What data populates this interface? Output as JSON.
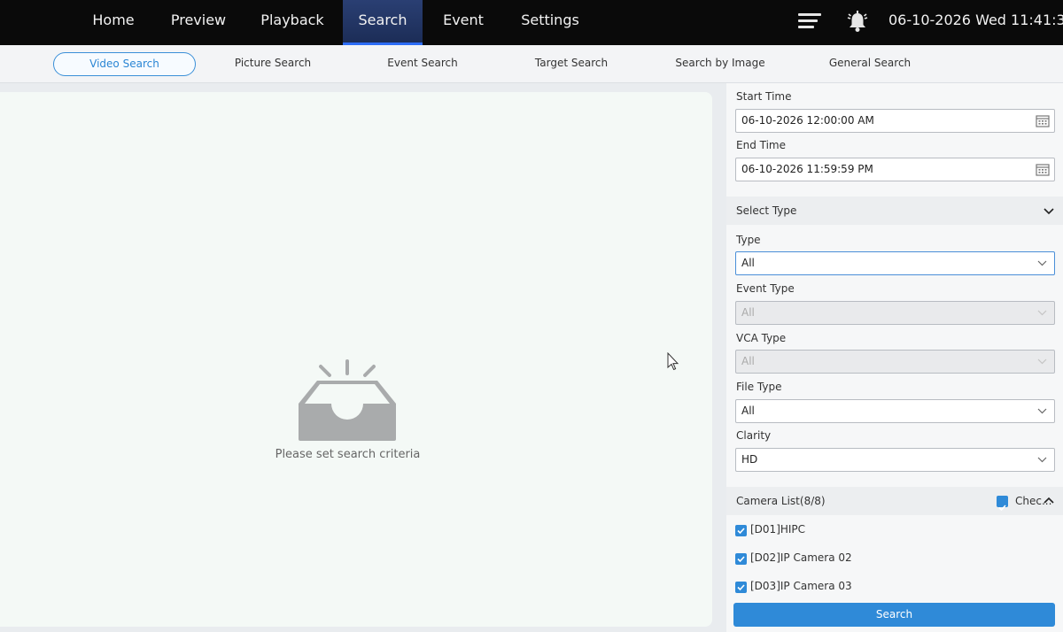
{
  "topnav": {
    "items": [
      {
        "label": "Home"
      },
      {
        "label": "Preview"
      },
      {
        "label": "Playback"
      },
      {
        "label": "Search"
      },
      {
        "label": "Event"
      },
      {
        "label": "Settings"
      }
    ],
    "active": "Search",
    "clock": "06-10-2026 Wed 11:41:30",
    "icons": [
      "menu-icon",
      "bell-icon"
    ]
  },
  "subnav": {
    "items": [
      {
        "label": "Video Search"
      },
      {
        "label": "Picture Search"
      },
      {
        "label": "Event Search"
      },
      {
        "label": "Target Search"
      },
      {
        "label": "Search by Image"
      },
      {
        "label": "General Search"
      }
    ],
    "active": "Video Search"
  },
  "main": {
    "empty_text": "Please set search criteria"
  },
  "panel": {
    "start_time_label": "Start Time",
    "start_time_value": "06-10-2026 12:00:00 AM",
    "end_time_label": "End Time",
    "end_time_value": "06-10-2026 11:59:59 PM",
    "select_type_title": "Select Type",
    "type_label": "Type",
    "type_value": "All",
    "event_type_label": "Event Type",
    "event_type_value": "All",
    "vca_type_label": "VCA Type",
    "vca_type_value": "All",
    "file_type_label": "File Type",
    "file_type_value": "All",
    "clarity_label": "Clarity",
    "clarity_value": "HD",
    "camera_list_title": "Camera List(8/8)",
    "check_all_label": "Chec...",
    "cameras": [
      {
        "label": "[D01]HIPC",
        "checked": true
      },
      {
        "label": "[D02]IP Camera 02",
        "checked": true
      },
      {
        "label": "[D03]IP Camera 03",
        "checked": true
      }
    ],
    "search_button": "Search"
  },
  "colors": {
    "accent": "#2f8ad8",
    "topbar": "#0a0a0a",
    "active_tab": "#1c2d57"
  }
}
